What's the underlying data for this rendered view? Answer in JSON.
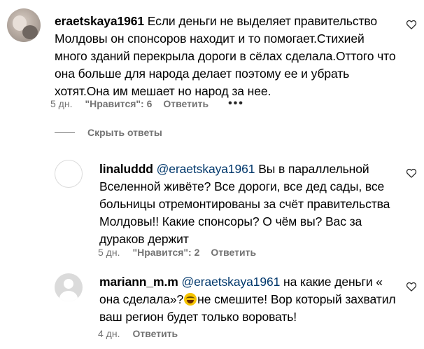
{
  "comments": [
    {
      "username": "eraetskaya1961",
      "lines": [
        "Если деньги не выделяет правительство",
        "Молдовы он спонсоров находит и то помогает.Стихией",
        "много зданий перекрыла дороги в сёлах сделала.Оттого что",
        "она больше для народа делает поэтому ее и убрать",
        "хотят.Она им мешает но народ за нее."
      ],
      "time": "5 дн.",
      "likes": "\"Нравится\": 6",
      "reply": "Ответить",
      "more": "•••"
    },
    {
      "username": "linaluddd",
      "mention": "@eraetskaya1961",
      "lines": [
        "Вы в параллельной",
        "Вселенной живёте? Все дороги, все дед сады, все",
        "больницы отремонтированы за счёт правительства",
        "Молдовы!! Какие спонсоры? О чём вы? Вас за",
        "дураков держит"
      ],
      "time": "5 дн.",
      "likes": "\"Нравится\": 2",
      "reply": "Ответить"
    },
    {
      "username": "mariann_m.m",
      "mention": "@eraetskaya1961",
      "lines": [
        "на какие деньги «",
        "она сделала»?",
        "не смешите! Вор который захватил",
        "ваш регион будет только воровать!"
      ],
      "emoji": "grinning-sweat-emoji",
      "time": "4 дн.",
      "reply": "Ответить"
    }
  ],
  "hide_replies_label": "Скрыть ответы",
  "icons": {
    "like": "heart-icon",
    "more": "more-options-icon",
    "avatar_default": "default-user-icon"
  },
  "colors": {
    "mention": "#00376b",
    "meta": "#737373"
  }
}
